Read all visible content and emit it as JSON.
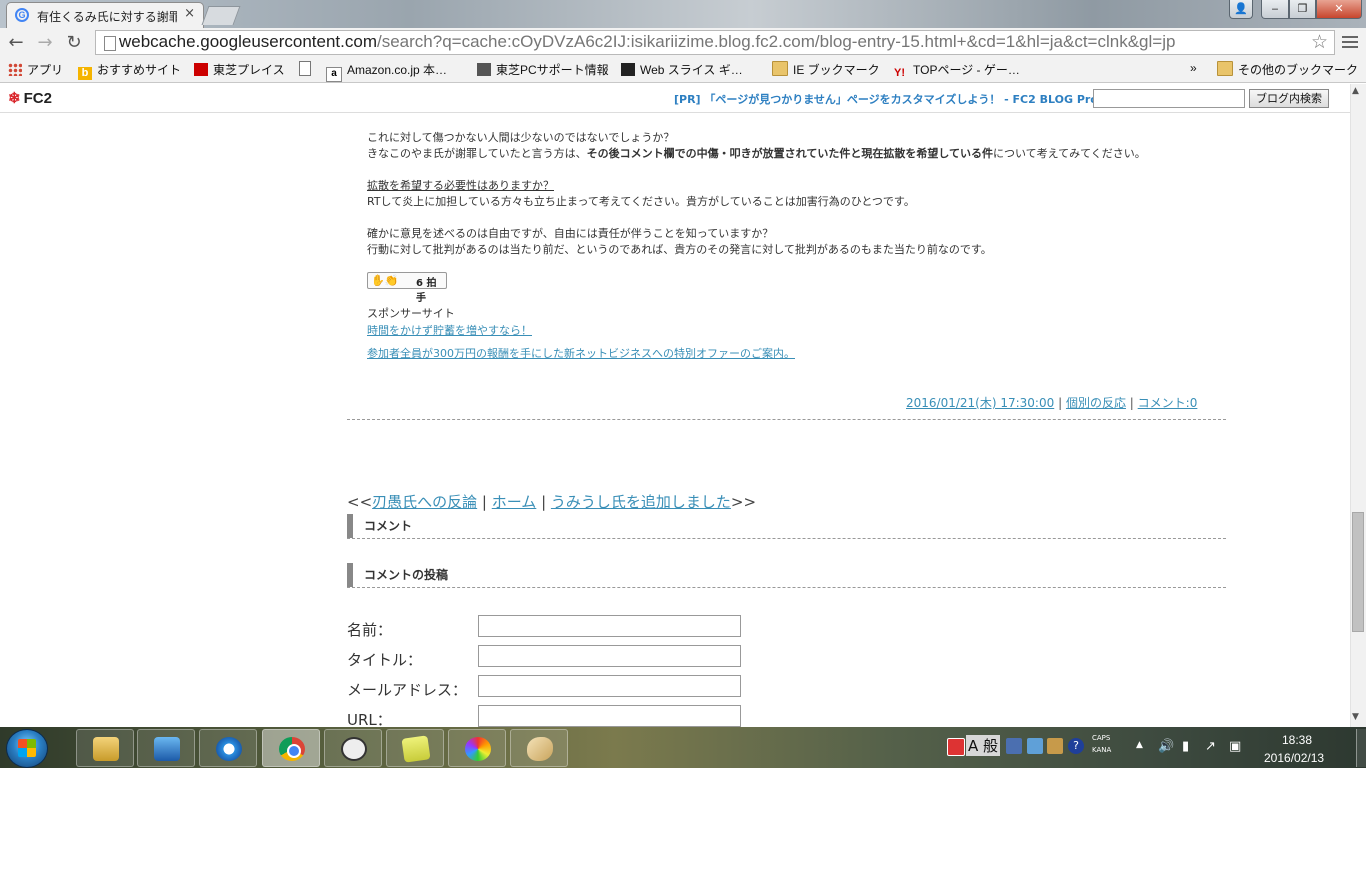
{
  "browser": {
    "tab_title": "有住くるみ氏に対する謝罪",
    "tab_close": "×",
    "url_host": "webcache.googleusercontent.com",
    "url_path": "/search?q=cache:cOyDVzA6c2IJ:isikariizime.blog.fc2.com/blog-entry-15.html+&cd=1&hl=ja&ct=clnk&gl=jp",
    "bookmarks": [
      {
        "label": "アプリ",
        "icon": "apps-icon"
      },
      {
        "label": "おすすめサイト",
        "icon": "bing-icon"
      },
      {
        "label": "東芝プレイス",
        "icon": "toshiba-icon"
      },
      {
        "label": "",
        "icon": "page-icon"
      },
      {
        "label": "Amazon.co.jp 本…",
        "icon": "amazon-icon"
      },
      {
        "label": "東芝PCサポート情報",
        "icon": "pc-icon"
      },
      {
        "label": "Web スライス ギ…",
        "icon": "webslice-icon"
      },
      {
        "label": "IE ブックマーク",
        "icon": "folder-icon"
      },
      {
        "label": "TOPページ - ゲー…",
        "icon": "yahoo-icon"
      }
    ],
    "bookmarks_more": "»",
    "other_bookmarks": "その他のブックマーク"
  },
  "fc2": {
    "logo": "FC2",
    "pr_text": "[PR] 「ページが見つかりません」ページをカスタマイズしよう！ - FC2 BLOG Pro",
    "search_placeholder": "",
    "search_button": "ブログ内検索"
  },
  "article": {
    "line1": "これに対して傷つかない人間は少ないのではないでしょうか？",
    "line2_a": "きなこのやま氏が謝罪していたと言う方は、",
    "line2_b": "その後コメント欄での中傷・叩きが放置されていた件と現在拡散を希望している件",
    "line2_c": "について考えてみてください。",
    "line3": "拡散を希望する必要性はありますか？",
    "line4": "RTして炎上に加担している方々も立ち止まって考えてください。貴方がしていることは加害行為のひとつです。",
    "line5": "確かに意見を述べるのは自由ですが、自由には責任が伴うことを知っていますか？",
    "line6": "行動に対して批判があるのは当たり前だ、というのであれば、貴方のその発言に対して批判があるのもまた当たり前なのです。",
    "clap_count": "6 拍手",
    "sponsor_label": "スポンサーサイト",
    "sponsor_link1": "時間をかけず貯蓄を増やすなら！",
    "sponsor_link2": "参加者全員が300万円の報酬を手にした新ネットビジネスへの特別オファーのご案内。",
    "date": "2016/01/21(木) 17:30:00",
    "sep": "|",
    "category": "個別の反応",
    "sep2": " |",
    "comments": "コメント:0"
  },
  "pager": {
    "prev_mark": "<<",
    "prev": "刃愚氏への反論",
    "sep1": " | ",
    "home": "ホーム",
    "sep2": " | ",
    "next": "うみうし氏を追加しました",
    "next_mark": ">>"
  },
  "comments_section": {
    "heading": "コメント",
    "post_heading": "コメントの投稿",
    "labels": {
      "name": "名前：",
      "title": "タイトル：",
      "email": "メールアドレス：",
      "url": "URL："
    }
  },
  "taskbar": {
    "caps": "CAPS",
    "kana": "KANA",
    "ime": "A 般",
    "time": "18:38",
    "date": "2016/02/13"
  }
}
